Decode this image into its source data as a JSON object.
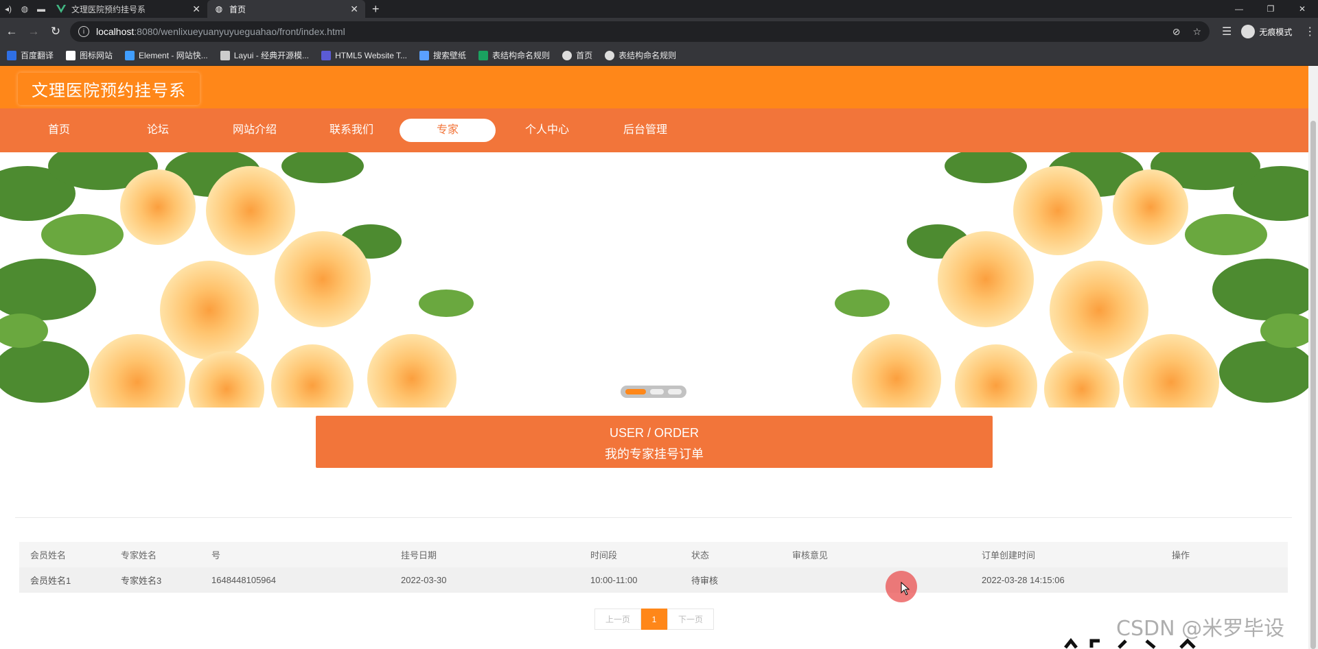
{
  "browser": {
    "tabs": [
      {
        "title": "文理医院预约挂号系"
      },
      {
        "title": "首页"
      }
    ],
    "url_host": "localhost",
    "url_rest": ":8080/wenlixueyuanyuyueguahao/front/index.html",
    "profile_label": "无痕模式",
    "bookmarks": [
      {
        "label": "百度翻译",
        "icon": "translate-icon",
        "color": "#2f6fe4"
      },
      {
        "label": "图标网站",
        "icon": "flag-icon",
        "color": "#ffffff"
      },
      {
        "label": "Element - 网站快...",
        "icon": "element-icon",
        "color": "#409eff"
      },
      {
        "label": "Layui - 经典开源模...",
        "icon": "layui-icon",
        "color": "#cccccc"
      },
      {
        "label": "HTML5 Website T...",
        "icon": "html5-icon",
        "color": "#5b5bd6"
      },
      {
        "label": "搜索壁纸",
        "icon": "wallpaper-icon",
        "color": "#5aa0ff"
      },
      {
        "label": "表结构命名规则",
        "icon": "doc-icon",
        "color": "#1aa260"
      },
      {
        "label": "首页",
        "icon": "globe-icon",
        "color": "#dddddd"
      },
      {
        "label": "表结构命名规则",
        "icon": "globe-icon",
        "color": "#dddddd"
      }
    ]
  },
  "site": {
    "title": "文理医院预约挂号系",
    "accent": "#ff8719",
    "nav_color": "#f2753a",
    "nav": [
      {
        "label": "首页",
        "active": false
      },
      {
        "label": "论坛",
        "active": false
      },
      {
        "label": "网站介绍",
        "active": false
      },
      {
        "label": "联系我们",
        "active": false
      },
      {
        "label": "专家",
        "active": true
      },
      {
        "label": "个人中心",
        "active": false
      },
      {
        "label": "后台管理",
        "active": false
      }
    ],
    "carousel": {
      "slides": 3,
      "active_index": 0
    }
  },
  "section": {
    "title_en": "USER / ORDER",
    "title_cn": "我的专家挂号订单"
  },
  "table": {
    "headers": [
      "会员姓名",
      "专家姓名",
      "号",
      "挂号日期",
      "时间段",
      "状态",
      "审核意见",
      "订单创建时间",
      "操作"
    ],
    "rows": [
      [
        "会员姓名1",
        "专家姓名3",
        "1648448105964",
        "2022-03-30",
        "10:00-11:00",
        "待审核",
        "",
        "2022-03-28 14:15:06",
        ""
      ]
    ]
  },
  "pagination": {
    "prev": "上一页",
    "current": "1",
    "next": "下一页"
  },
  "watermark": "CSDN @米罗毕设"
}
